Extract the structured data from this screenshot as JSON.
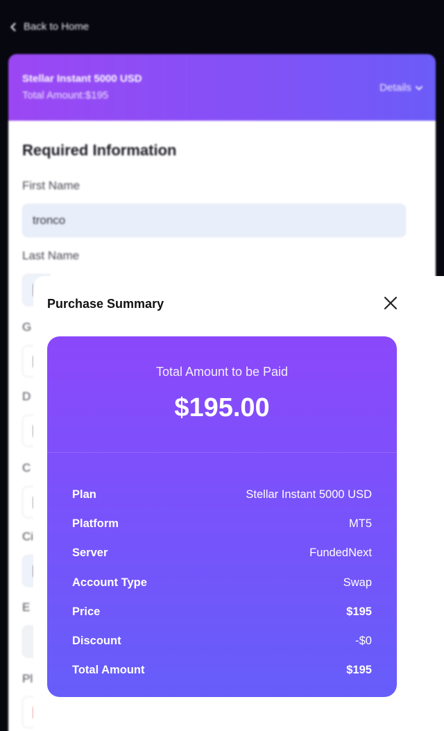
{
  "nav": {
    "back_label": "Back to Home"
  },
  "plan_header": {
    "title": "Stellar Instant 5000 USD",
    "amount": "Total Amount:$195",
    "details_label": "Details"
  },
  "form": {
    "heading": "Required Information",
    "first_name_label": "First Name",
    "first_name_value": "tronco",
    "last_name_label": "Last Name",
    "partial_labels": [
      "G",
      "D",
      "C",
      "Ci",
      "E",
      "Pl"
    ]
  },
  "modal": {
    "title": "Purchase Summary",
    "caption": "Total Amount to be Paid",
    "total": "$195.00",
    "rows": [
      {
        "label": "Plan",
        "value": "Stellar Instant 5000 USD"
      },
      {
        "label": "Platform",
        "value": "MT5"
      },
      {
        "label": "Server",
        "value": "FundedNext"
      },
      {
        "label": "Account Type",
        "value": "Swap"
      },
      {
        "label": "Price",
        "value": "$195"
      },
      {
        "label": "Discount",
        "value": "-$0"
      },
      {
        "label": "Total Amount",
        "value": "$195"
      }
    ]
  },
  "colors": {
    "header_gradient_start": "#9b47f3",
    "header_gradient_end": "#6c5cf7",
    "card_gradient_top": "#8b48fb",
    "card_gradient_bottom": "#665dfa",
    "page_background": "#07070f"
  },
  "icons": {
    "back": "chevron-left-icon",
    "details": "chevron-down-icon",
    "close": "close-icon"
  }
}
